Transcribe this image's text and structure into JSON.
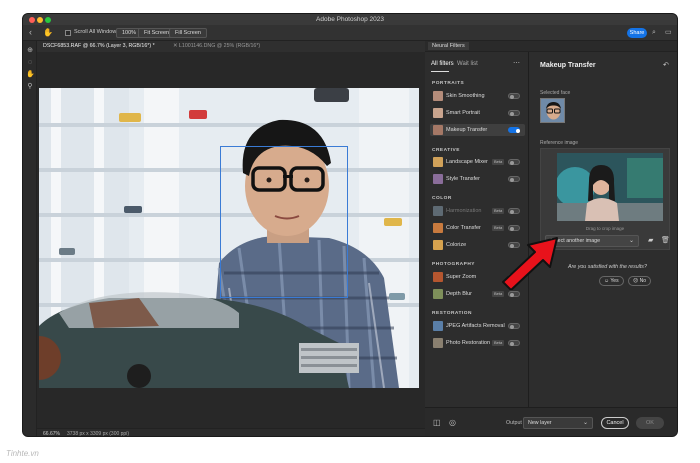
{
  "window": {
    "title": "Adobe Photoshop 2023"
  },
  "options_bar": {
    "scroll_all_windows": "Scroll All Windows",
    "zoom_100": "100%",
    "fit_screen": "Fit Screen",
    "fill_screen": "Fill Screen",
    "share": "Share"
  },
  "doc_tabs": [
    {
      "label": "DSCF6853.RAF @ 66.7% (Layer 3, RGB/16*) *"
    },
    {
      "label": "L1001146.DNG @ 25% (RGB/16*)"
    }
  ],
  "status_bar": {
    "zoom": "66.67%",
    "dimensions": "3738 px x 3309 px (300 ppi)"
  },
  "neural_filters": {
    "panel_tab": "Neural Filters",
    "tabs": {
      "all": "All filters",
      "wait": "Wait list"
    },
    "sections": [
      {
        "label": "PORTRAITS"
      },
      {
        "label": "CREATIVE"
      },
      {
        "label": "COLOR"
      },
      {
        "label": "PHOTOGRAPHY"
      },
      {
        "label": "RESTORATION"
      }
    ],
    "filters": [
      {
        "name": "Skin Smoothing",
        "on": false,
        "beta": "",
        "thumb": "#b48c7a"
      },
      {
        "name": "Smart Portrait",
        "on": false,
        "beta": "",
        "thumb": "#c9a48e"
      },
      {
        "name": "Makeup Transfer",
        "on": true,
        "beta": "",
        "thumb": "#a57866"
      },
      {
        "name": "Landscape Mixer",
        "on": false,
        "beta": "Beta",
        "thumb": "#d1a25a"
      },
      {
        "name": "Style Transfer",
        "on": false,
        "beta": "",
        "thumb": "#8a6d9a"
      },
      {
        "name": "Harmonization",
        "on": false,
        "beta": "Beta",
        "thumb": "#5e6a73"
      },
      {
        "name": "Color Transfer",
        "on": false,
        "beta": "Beta",
        "thumb": "#c87a3e"
      },
      {
        "name": "Colorize",
        "on": false,
        "beta": "",
        "thumb": "#d6a24e"
      },
      {
        "name": "Super Zoom",
        "on": false,
        "beta": "",
        "thumb": "#b5562f"
      },
      {
        "name": "Depth Blur",
        "on": false,
        "beta": "Beta",
        "thumb": "#7e8f5a"
      },
      {
        "name": "JPEG Artifacts Removal",
        "on": false,
        "beta": "",
        "thumb": "#5a7fa8"
      },
      {
        "name": "Photo Restoration",
        "on": false,
        "beta": "Beta",
        "thumb": "#8a8070"
      }
    ],
    "detail": {
      "title": "Makeup Transfer",
      "selected_face": "Selected face",
      "reference_image": "Reference image",
      "drag_to_crop": "Drag to crop image",
      "select_another": "Select another image",
      "satisfied": "Are you satisfied with the results?",
      "yes": "Yes",
      "no": "No"
    },
    "bottom": {
      "output_label": "Output",
      "output_value": "New layer",
      "cancel": "Cancel",
      "ok": "OK"
    }
  },
  "watermark": "Tinhte.vn"
}
